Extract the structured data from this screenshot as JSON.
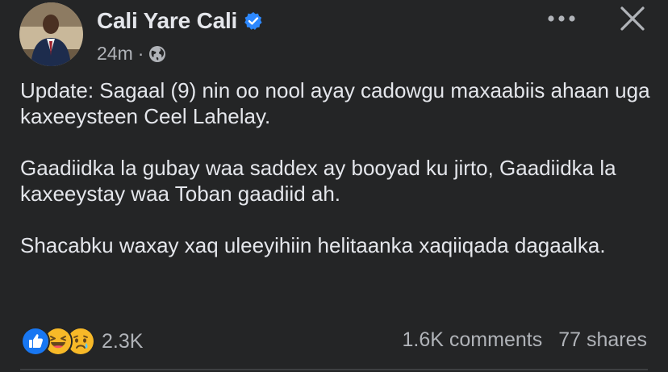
{
  "post": {
    "author": {
      "name": "Cali Yare Cali",
      "verified": true
    },
    "timestamp": "24m",
    "separator": "·",
    "privacy_icon": "globe-icon",
    "paragraphs": [
      "Update: Sagaal (9) nin oo nool ayay cadowgu maxaabiis ahaan uga kaxeeysteen Ceel Lahelay.",
      "Gaadiidka la gubay waa saddex ay booyad ku jirto, Gaadiidka la kaxeeystay waa Toban gaadiid ah.",
      "Shacabku waxay xaq uleeyihiin helitaanka xaqiiqada dagaalka."
    ],
    "reactions": {
      "icons": [
        "like-icon",
        "haha-icon",
        "sad-icon"
      ],
      "count": "2.3K"
    },
    "comments": "1.6K comments",
    "shares": "77 shares"
  },
  "colors": {
    "background": "#242526",
    "text_primary": "#e4e6eb",
    "text_secondary": "#b0b3b8",
    "like_blue": "#1877f2",
    "emoji_yellow": "#f7b928",
    "verified_blue": "#2d88ff"
  }
}
